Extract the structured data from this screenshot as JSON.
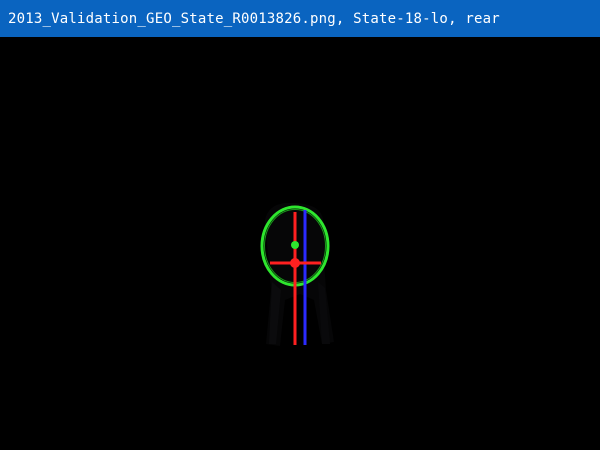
{
  "window": {
    "title": "2013_Validation_GEO_State_R0013826.png, State-18-lo, rear"
  },
  "colors": {
    "title_bar": "#0a64c0",
    "title_text": "#ffffff",
    "background": "#000000",
    "ellipse": "#2ee62e",
    "horizontal_marker": "#ff2020",
    "vertical_red": "#ff2020",
    "vertical_blue": "#2b2bff",
    "center_dot": "#ff2020",
    "green_dot": "#2ee62e"
  },
  "icons": {
    "horizontal_marker": "horizontal-red-line",
    "vertical_red_marker": "vertical-red-line",
    "vertical_blue_marker": "vertical-blue-line",
    "center_marker": "red-center-dot",
    "green_marker": "green-dot",
    "detection_ellipse": "green-ellipse"
  }
}
